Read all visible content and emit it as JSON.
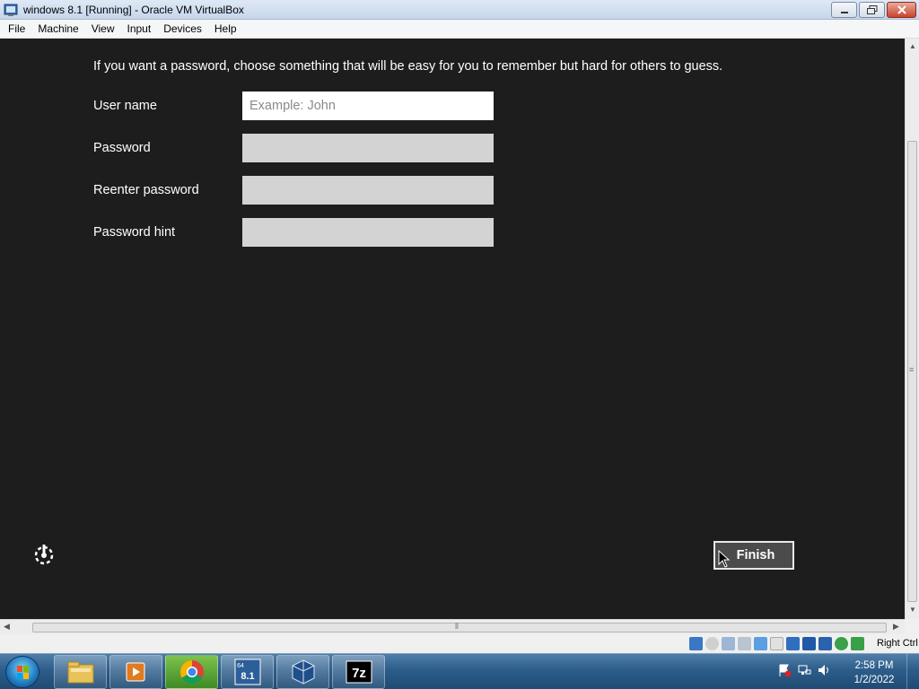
{
  "window": {
    "title": "windows 8.1 [Running] - Oracle VM VirtualBox"
  },
  "menubar": {
    "items": [
      "File",
      "Machine",
      "View",
      "Input",
      "Devices",
      "Help"
    ]
  },
  "setup": {
    "intro": "If you want a password, choose something that will be easy for you to remember but hard for others to guess.",
    "fields": [
      {
        "label": "User name",
        "placeholder": "Example: John",
        "value": ""
      },
      {
        "label": "Password",
        "placeholder": "",
        "value": ""
      },
      {
        "label": "Reenter password",
        "placeholder": "",
        "value": ""
      },
      {
        "label": "Password hint",
        "placeholder": "",
        "value": ""
      }
    ],
    "finish_label": "Finish"
  },
  "statusbar": {
    "host_key": "Right Ctrl",
    "icons": [
      "hard-disk-icon",
      "optical-drive-icon",
      "audio-icon",
      "network-icon",
      "usb-icon",
      "shared-folders-icon",
      "display-icon",
      "recording-icon",
      "vt-x-icon",
      "mouse-integration-icon",
      "host-key-icon"
    ]
  },
  "taskbar": {
    "apps": [
      "file-explorer-icon",
      "media-player-icon",
      "chrome-icon",
      "windows-8-1-vm-icon",
      "virtualbox-icon",
      "7zip-icon"
    ],
    "time": "2:58 PM",
    "date": "1/2/2022",
    "app_labels": {
      "vm": "8.1",
      "sevenzip": "7z",
      "bits": "64"
    }
  },
  "colors": {
    "vm_background": "#1d1d1d",
    "input_active": "#ffffff",
    "input_inactive": "#d3d3d3",
    "finish_button": "#4b4b4b",
    "taskbar": "#2d5d8a"
  }
}
